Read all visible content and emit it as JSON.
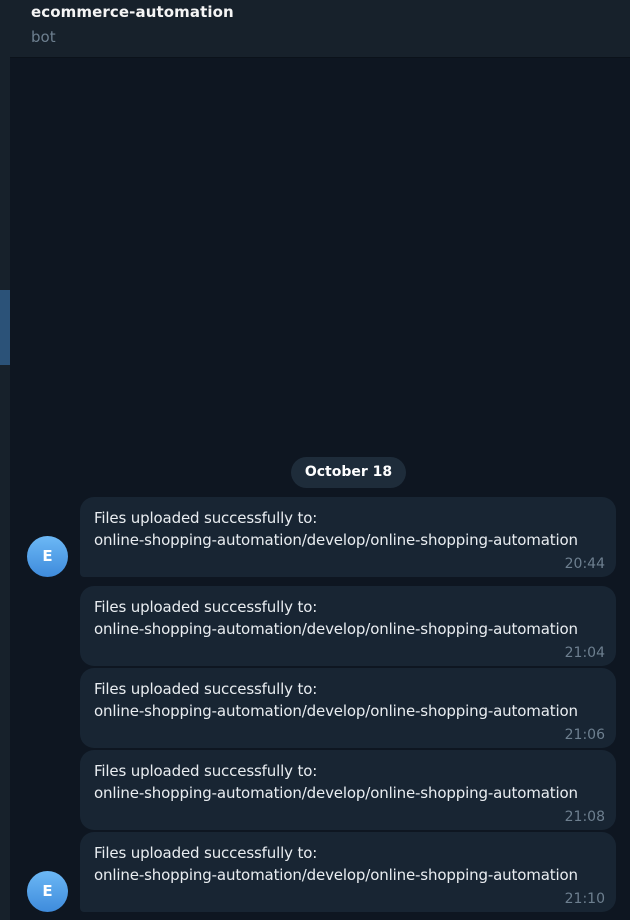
{
  "header": {
    "title": "ecommerce-automation",
    "subtitle": "bot"
  },
  "chat": {
    "date_separator": "October 18",
    "avatar_letter": "E",
    "messages": [
      {
        "line1": "Files uploaded successfully to:",
        "line2": "online-shopping-automation/develop/online-shopping-automation",
        "time": "20:44"
      },
      {
        "line1": "Files uploaded successfully to:",
        "line2": "online-shopping-automation/develop/online-shopping-automation",
        "time": "21:04"
      },
      {
        "line1": "Files uploaded successfully to:",
        "line2": "online-shopping-automation/develop/online-shopping-automation",
        "time": "21:06"
      },
      {
        "line1": "Files uploaded successfully to:",
        "line2": "online-shopping-automation/develop/online-shopping-automation",
        "time": "21:08"
      },
      {
        "line1": "Files uploaded successfully to:",
        "line2": "online-shopping-automation/develop/online-shopping-automation",
        "time": "21:10"
      }
    ]
  },
  "colors": {
    "background": "#0e1621",
    "header": "#17212b",
    "bubble": "#182533",
    "date_pill": "#1e2c3a",
    "avatar": "#4a96e0",
    "muted_text": "#6d7f8f"
  }
}
